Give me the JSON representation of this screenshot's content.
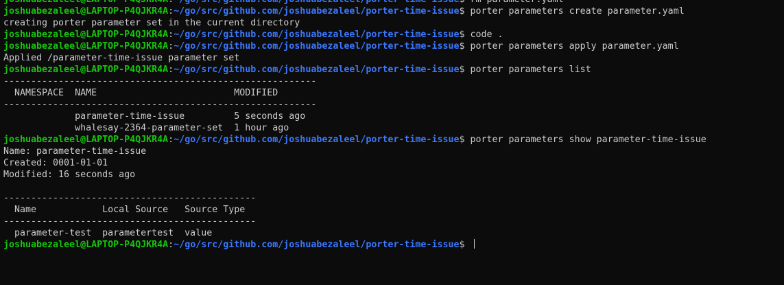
{
  "prompt": {
    "user_host": "joshuabezaleel@LAPTOP-P4QJKR4A",
    "colon": ":",
    "path": "~/go/src/github.com/joshuabezaleel/porter-time-issue",
    "symbol": "$"
  },
  "lines": [
    {
      "type": "prompt",
      "cmd": " rm parameter.yaml"
    },
    {
      "type": "prompt",
      "cmd": " porter parameters create parameter.yaml"
    },
    {
      "type": "output",
      "text": "creating porter parameter set in the current directory"
    },
    {
      "type": "prompt",
      "cmd": " code ."
    },
    {
      "type": "prompt",
      "cmd": " porter parameters apply parameter.yaml"
    },
    {
      "type": "output",
      "text": "Applied /parameter-time-issue parameter set"
    },
    {
      "type": "prompt",
      "cmd": " porter parameters list"
    },
    {
      "type": "output",
      "text": "---------------------------------------------------------"
    },
    {
      "type": "output",
      "text": "  NAMESPACE  NAME                         MODIFIED"
    },
    {
      "type": "output",
      "text": "---------------------------------------------------------"
    },
    {
      "type": "output",
      "text": "             parameter-time-issue         5 seconds ago"
    },
    {
      "type": "output",
      "text": "             whalesay-2364-parameter-set  1 hour ago"
    },
    {
      "type": "prompt",
      "cmd": " porter parameters show parameter-time-issue"
    },
    {
      "type": "output",
      "text": "Name: parameter-time-issue"
    },
    {
      "type": "output",
      "text": "Created: 0001-01-01"
    },
    {
      "type": "output",
      "text": "Modified: 16 seconds ago"
    },
    {
      "type": "output",
      "text": ""
    },
    {
      "type": "output",
      "text": "----------------------------------------------"
    },
    {
      "type": "output",
      "text": "  Name            Local Source   Source Type"
    },
    {
      "type": "output",
      "text": "----------------------------------------------"
    },
    {
      "type": "output",
      "text": "  parameter-test  parametertest  value"
    },
    {
      "type": "prompt",
      "cmd": " ",
      "cursor": true
    }
  ]
}
